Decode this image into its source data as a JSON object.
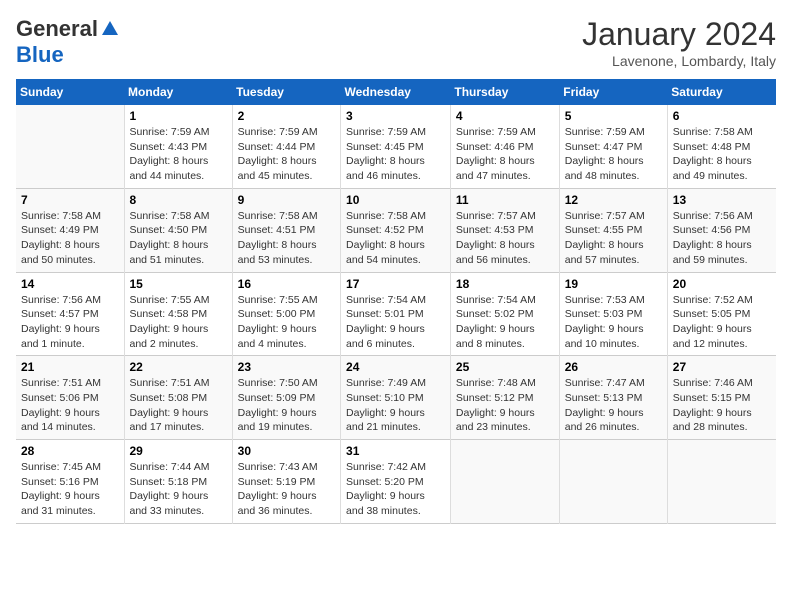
{
  "header": {
    "logo_general": "General",
    "logo_blue": "Blue",
    "title": "January 2024",
    "subtitle": "Lavenone, Lombardy, Italy"
  },
  "days_of_week": [
    "Sunday",
    "Monday",
    "Tuesday",
    "Wednesday",
    "Thursday",
    "Friday",
    "Saturday"
  ],
  "weeks": [
    [
      {
        "day": "",
        "sunrise": "",
        "sunset": "",
        "daylight": ""
      },
      {
        "day": "1",
        "sunrise": "Sunrise: 7:59 AM",
        "sunset": "Sunset: 4:43 PM",
        "daylight": "Daylight: 8 hours and 44 minutes."
      },
      {
        "day": "2",
        "sunrise": "Sunrise: 7:59 AM",
        "sunset": "Sunset: 4:44 PM",
        "daylight": "Daylight: 8 hours and 45 minutes."
      },
      {
        "day": "3",
        "sunrise": "Sunrise: 7:59 AM",
        "sunset": "Sunset: 4:45 PM",
        "daylight": "Daylight: 8 hours and 46 minutes."
      },
      {
        "day": "4",
        "sunrise": "Sunrise: 7:59 AM",
        "sunset": "Sunset: 4:46 PM",
        "daylight": "Daylight: 8 hours and 47 minutes."
      },
      {
        "day": "5",
        "sunrise": "Sunrise: 7:59 AM",
        "sunset": "Sunset: 4:47 PM",
        "daylight": "Daylight: 8 hours and 48 minutes."
      },
      {
        "day": "6",
        "sunrise": "Sunrise: 7:58 AM",
        "sunset": "Sunset: 4:48 PM",
        "daylight": "Daylight: 8 hours and 49 minutes."
      }
    ],
    [
      {
        "day": "7",
        "sunrise": "Sunrise: 7:58 AM",
        "sunset": "Sunset: 4:49 PM",
        "daylight": "Daylight: 8 hours and 50 minutes."
      },
      {
        "day": "8",
        "sunrise": "Sunrise: 7:58 AM",
        "sunset": "Sunset: 4:50 PM",
        "daylight": "Daylight: 8 hours and 51 minutes."
      },
      {
        "day": "9",
        "sunrise": "Sunrise: 7:58 AM",
        "sunset": "Sunset: 4:51 PM",
        "daylight": "Daylight: 8 hours and 53 minutes."
      },
      {
        "day": "10",
        "sunrise": "Sunrise: 7:58 AM",
        "sunset": "Sunset: 4:52 PM",
        "daylight": "Daylight: 8 hours and 54 minutes."
      },
      {
        "day": "11",
        "sunrise": "Sunrise: 7:57 AM",
        "sunset": "Sunset: 4:53 PM",
        "daylight": "Daylight: 8 hours and 56 minutes."
      },
      {
        "day": "12",
        "sunrise": "Sunrise: 7:57 AM",
        "sunset": "Sunset: 4:55 PM",
        "daylight": "Daylight: 8 hours and 57 minutes."
      },
      {
        "day": "13",
        "sunrise": "Sunrise: 7:56 AM",
        "sunset": "Sunset: 4:56 PM",
        "daylight": "Daylight: 8 hours and 59 minutes."
      }
    ],
    [
      {
        "day": "14",
        "sunrise": "Sunrise: 7:56 AM",
        "sunset": "Sunset: 4:57 PM",
        "daylight": "Daylight: 9 hours and 1 minute."
      },
      {
        "day": "15",
        "sunrise": "Sunrise: 7:55 AM",
        "sunset": "Sunset: 4:58 PM",
        "daylight": "Daylight: 9 hours and 2 minutes."
      },
      {
        "day": "16",
        "sunrise": "Sunrise: 7:55 AM",
        "sunset": "Sunset: 5:00 PM",
        "daylight": "Daylight: 9 hours and 4 minutes."
      },
      {
        "day": "17",
        "sunrise": "Sunrise: 7:54 AM",
        "sunset": "Sunset: 5:01 PM",
        "daylight": "Daylight: 9 hours and 6 minutes."
      },
      {
        "day": "18",
        "sunrise": "Sunrise: 7:54 AM",
        "sunset": "Sunset: 5:02 PM",
        "daylight": "Daylight: 9 hours and 8 minutes."
      },
      {
        "day": "19",
        "sunrise": "Sunrise: 7:53 AM",
        "sunset": "Sunset: 5:03 PM",
        "daylight": "Daylight: 9 hours and 10 minutes."
      },
      {
        "day": "20",
        "sunrise": "Sunrise: 7:52 AM",
        "sunset": "Sunset: 5:05 PM",
        "daylight": "Daylight: 9 hours and 12 minutes."
      }
    ],
    [
      {
        "day": "21",
        "sunrise": "Sunrise: 7:51 AM",
        "sunset": "Sunset: 5:06 PM",
        "daylight": "Daylight: 9 hours and 14 minutes."
      },
      {
        "day": "22",
        "sunrise": "Sunrise: 7:51 AM",
        "sunset": "Sunset: 5:08 PM",
        "daylight": "Daylight: 9 hours and 17 minutes."
      },
      {
        "day": "23",
        "sunrise": "Sunrise: 7:50 AM",
        "sunset": "Sunset: 5:09 PM",
        "daylight": "Daylight: 9 hours and 19 minutes."
      },
      {
        "day": "24",
        "sunrise": "Sunrise: 7:49 AM",
        "sunset": "Sunset: 5:10 PM",
        "daylight": "Daylight: 9 hours and 21 minutes."
      },
      {
        "day": "25",
        "sunrise": "Sunrise: 7:48 AM",
        "sunset": "Sunset: 5:12 PM",
        "daylight": "Daylight: 9 hours and 23 minutes."
      },
      {
        "day": "26",
        "sunrise": "Sunrise: 7:47 AM",
        "sunset": "Sunset: 5:13 PM",
        "daylight": "Daylight: 9 hours and 26 minutes."
      },
      {
        "day": "27",
        "sunrise": "Sunrise: 7:46 AM",
        "sunset": "Sunset: 5:15 PM",
        "daylight": "Daylight: 9 hours and 28 minutes."
      }
    ],
    [
      {
        "day": "28",
        "sunrise": "Sunrise: 7:45 AM",
        "sunset": "Sunset: 5:16 PM",
        "daylight": "Daylight: 9 hours and 31 minutes."
      },
      {
        "day": "29",
        "sunrise": "Sunrise: 7:44 AM",
        "sunset": "Sunset: 5:18 PM",
        "daylight": "Daylight: 9 hours and 33 minutes."
      },
      {
        "day": "30",
        "sunrise": "Sunrise: 7:43 AM",
        "sunset": "Sunset: 5:19 PM",
        "daylight": "Daylight: 9 hours and 36 minutes."
      },
      {
        "day": "31",
        "sunrise": "Sunrise: 7:42 AM",
        "sunset": "Sunset: 5:20 PM",
        "daylight": "Daylight: 9 hours and 38 minutes."
      },
      {
        "day": "",
        "sunrise": "",
        "sunset": "",
        "daylight": ""
      },
      {
        "day": "",
        "sunrise": "",
        "sunset": "",
        "daylight": ""
      },
      {
        "day": "",
        "sunrise": "",
        "sunset": "",
        "daylight": ""
      }
    ]
  ]
}
